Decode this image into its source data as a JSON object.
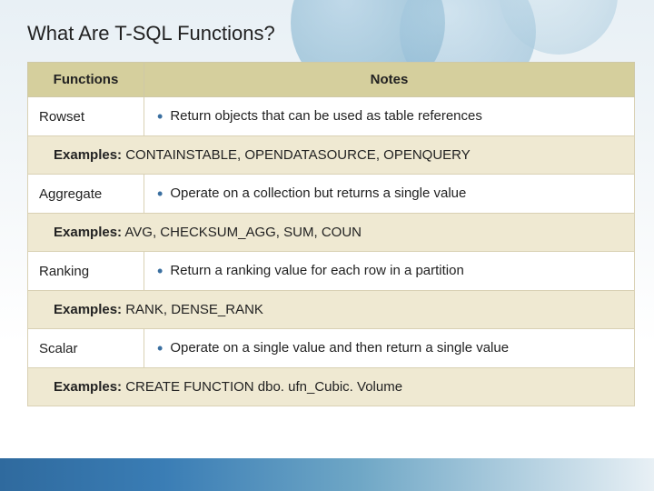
{
  "title": "What Are T-SQL Functions?",
  "headers": {
    "functions": "Functions",
    "notes": "Notes"
  },
  "bullet": "•",
  "examples_label": "Examples:",
  "rows": [
    {
      "name": "Rowset",
      "note": "Return objects that can be used as table references",
      "examples": "CONTAINSTABLE, OPENDATASOURCE, OPENQUERY"
    },
    {
      "name": "Aggregate",
      "note": "Operate on a collection but returns a single value",
      "examples": "AVG, CHECKSUM_AGG, SUM, COUN"
    },
    {
      "name": "Ranking",
      "note": "Return a ranking value for each row in a partition",
      "examples": "RANK, DENSE_RANK"
    },
    {
      "name": "Scalar",
      "note": "Operate on a single value and then return a single value",
      "examples": "CREATE FUNCTION dbo. ufn_Cubic. Volume"
    }
  ]
}
